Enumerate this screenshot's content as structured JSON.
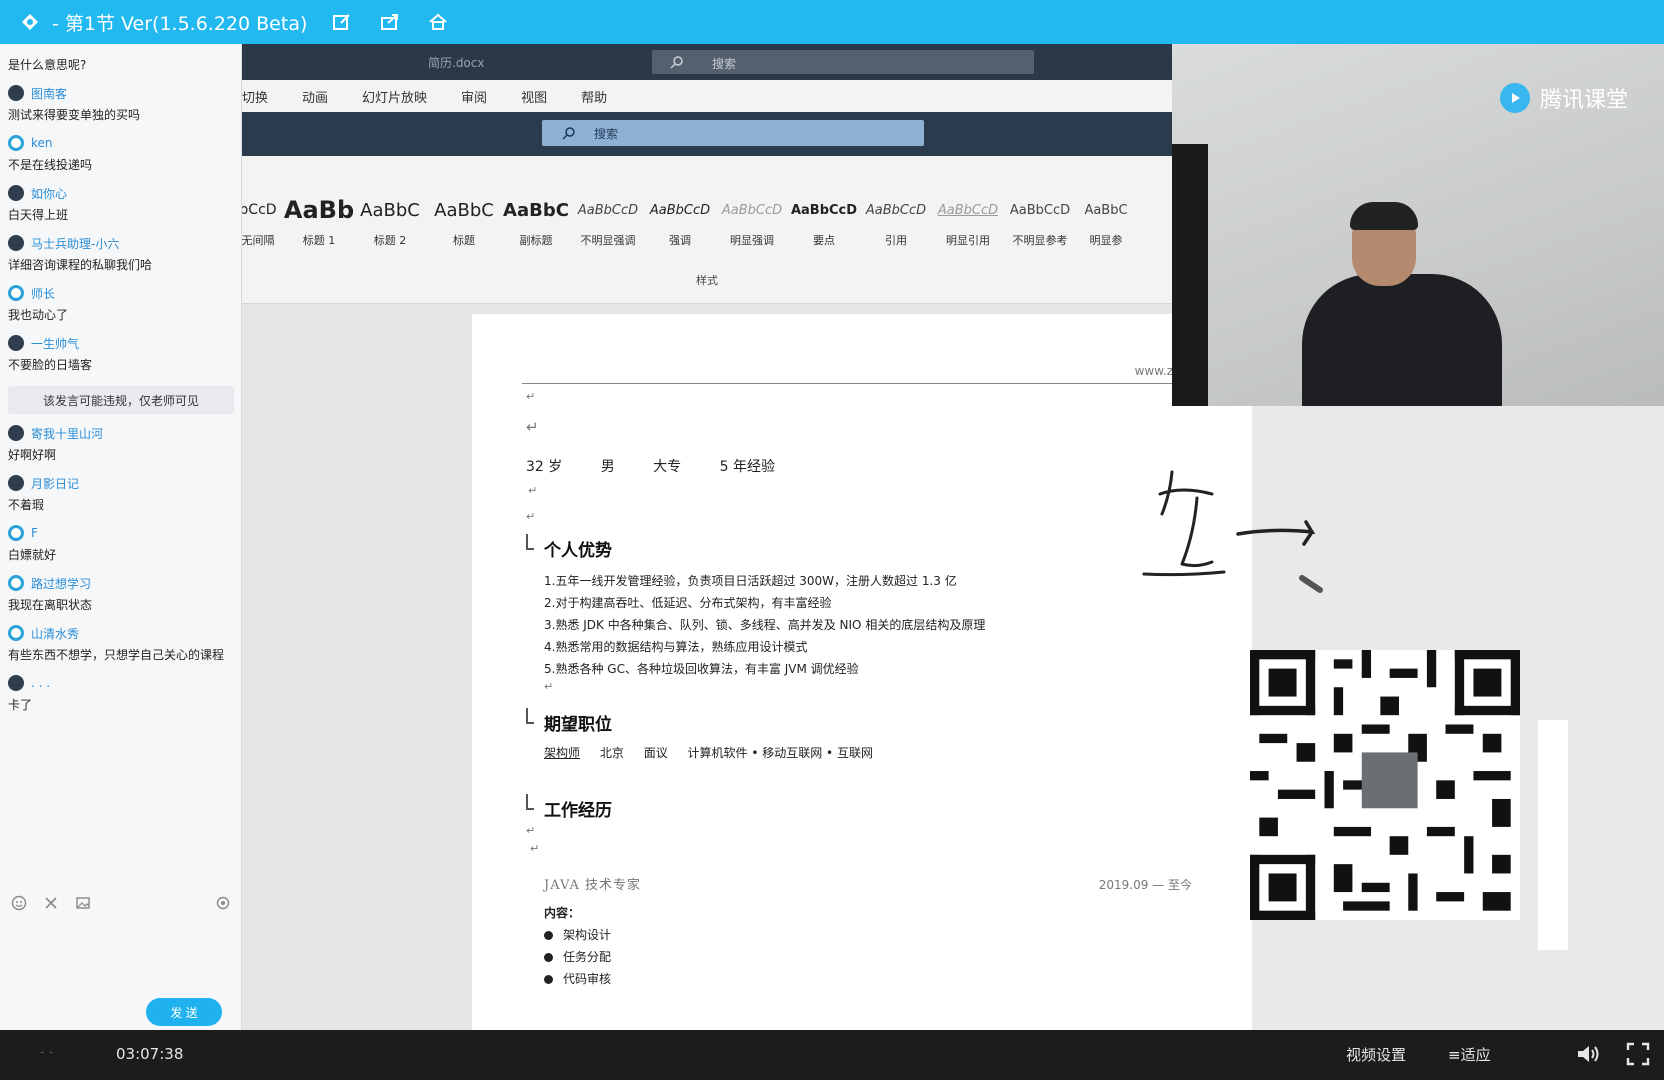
{
  "titlebar": {
    "title": "- 第1节 Ver(1.5.6.220 Beta)",
    "icons": [
      "app-logo-icon",
      "edit-icon",
      "share-icon",
      "home-icon"
    ]
  },
  "chat": {
    "messages": [
      {
        "nick": "",
        "text": "是什么意思呢?",
        "ring": false
      },
      {
        "nick": "图南客",
        "text": "测试来得要变单独的买吗",
        "ring": false
      },
      {
        "nick": "ken",
        "text": "不是在线投递吗",
        "ring": true
      },
      {
        "nick": "如你心",
        "text": "白天得上班",
        "ring": false
      },
      {
        "nick": "马士兵助理-小六",
        "text": "详细咨询课程的私聊我们哈",
        "ring": false
      },
      {
        "nick": "师长",
        "text": "我也动心了",
        "ring": true
      },
      {
        "nick": "一生帅气",
        "text": "不要脸的日墙客",
        "ring": false
      }
    ],
    "system_note": "该发言可能违规，仅老师可见",
    "messages2": [
      {
        "nick": "寄我十里山河",
        "text": "好啊好啊",
        "ring": false
      },
      {
        "nick": "月影日记",
        "text": "不着瑕",
        "ring": false
      },
      {
        "nick": "F",
        "text": "白嫖就好",
        "ring": true
      },
      {
        "nick": "路过想学习",
        "text": "我现在离职状态",
        "ring": true
      },
      {
        "nick": "山清水秀",
        "text": "有些东西不想学，只想学自己关心的课程",
        "ring": true
      },
      {
        "nick": ". . .",
        "text": "卡了",
        "ring": false
      }
    ],
    "send_label": "发 送"
  },
  "word": {
    "doc_name": "简历.docx",
    "search_top": "搜索",
    "tabs": [
      "切换",
      "动画",
      "幻灯片放映",
      "审阅",
      "视图",
      "帮助"
    ],
    "search_placeholder": "搜索",
    "styles": [
      {
        "sample": "bCcD",
        "name": "无间隔"
      },
      {
        "sample": "AaBb",
        "name": "标题 1"
      },
      {
        "sample": "AaBbC",
        "name": "标题 2"
      },
      {
        "sample": "AaBbC",
        "name": "标题"
      },
      {
        "sample": "AaBbC",
        "name": "副标题"
      },
      {
        "sample": "AaBbCcD",
        "name": "不明显强调"
      },
      {
        "sample": "AaBbCcD",
        "name": "强调"
      },
      {
        "sample": "AaBbCcD",
        "name": "明显强调"
      },
      {
        "sample": "AaBbCcD",
        "name": "要点"
      },
      {
        "sample": "AaBbCcD",
        "name": "引用"
      },
      {
        "sample": "AaBbCcD",
        "name": "明显引用"
      },
      {
        "sample": "AaBbCcD",
        "name": "不明显参考"
      },
      {
        "sample": "AaBbC",
        "name": "明显参"
      }
    ],
    "styles_group": "样式"
  },
  "resume": {
    "url": "www.zhipin.com",
    "age": "32 岁",
    "gender": "男",
    "education": "大专",
    "experience": "5 年经验",
    "sec_advantage": "个人优势",
    "advantages": [
      "1.五年一线开发管理经验，负责项目日活跃超过 300W，注册人数超过 1.3 亿",
      "2.对于构建高吞吐、低延迟、分布式架构，有丰富经验",
      "3.熟悉 JDK 中各种集合、队列、锁、多线程、高并发及 NIO 相关的底层结构及原理",
      "4.熟悉常用的数据结构与算法，熟练应用设计模式",
      "5.熟悉各种 GC、各种垃圾回收算法，有丰富 JVM 调优经验"
    ],
    "sec_expect": "期望职位",
    "expect": [
      "架构师",
      "北京",
      "面议",
      "计算机软件 • 移动互联网 • 互联网"
    ],
    "sec_work": "工作经历",
    "job_title": "JAVA 技术专家",
    "job_date": "2019.09 — 至今",
    "content_label": "内容：",
    "duties": [
      "架构设计",
      "任务分配",
      "代码审核"
    ]
  },
  "webcam": {
    "brand": "腾讯课堂"
  },
  "bottombar": {
    "lead": "- -",
    "time": "03:07:38",
    "video_settings": "视频设置",
    "fit": "适应"
  }
}
